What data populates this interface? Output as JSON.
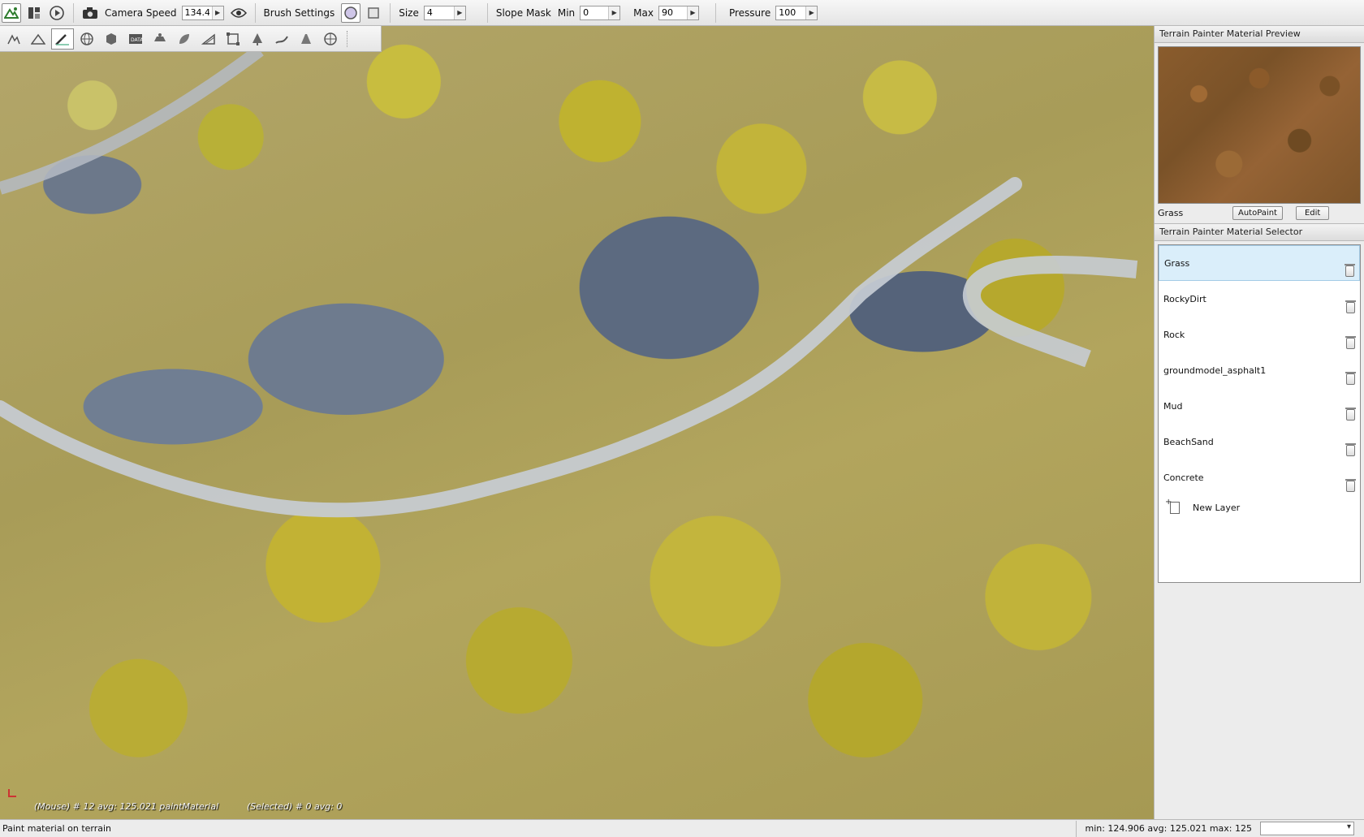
{
  "toolbar": {
    "camera_speed_label": "Camera Speed",
    "camera_speed_value": "134.45",
    "brush_settings_label": "Brush Settings",
    "size_label": "Size",
    "size_value": "4",
    "slope_mask_label": "Slope Mask",
    "min_label": "Min",
    "min_value": "0",
    "max_label": "Max",
    "max_value": "90",
    "pressure_label": "Pressure",
    "pressure_value": "100"
  },
  "tools": [
    "terrain-raise-icon",
    "terrain-smooth-icon",
    "paint-brush-icon",
    "globe-icon",
    "cube-icon",
    "datablock-icon",
    "road-icon",
    "leaf-icon",
    "ramp-icon",
    "select-box-icon",
    "forest-brush-icon",
    "river-icon",
    "mesh-road-icon",
    "decal-icon"
  ],
  "viewport": {
    "mouse_info": "(Mouse) # 12  avg: 125.021 paintMaterial",
    "selected_info": "(Selected) # 0  avg: 0"
  },
  "preview_panel": {
    "title": "Terrain Painter Material Preview",
    "material_name": "Grass",
    "autopaint_label": "AutoPaint",
    "edit_label": "Edit"
  },
  "selector_panel": {
    "title": "Terrain Painter Material Selector",
    "materials": [
      {
        "name": "Grass"
      },
      {
        "name": "RockyDirt"
      },
      {
        "name": "Rock"
      },
      {
        "name": "groundmodel_asphalt1"
      },
      {
        "name": "Mud"
      },
      {
        "name": "BeachSand"
      },
      {
        "name": "Concrete"
      }
    ],
    "selected_index": 0,
    "new_layer_label": "New Layer"
  },
  "status": {
    "left": "Paint material on terrain",
    "right": "min: 124.906  avg: 125.021  max: 125"
  },
  "colors": {
    "selection": "#daeefa",
    "grass_yellow": "#c2b43a",
    "rock_blue": "#6b7a8e"
  }
}
